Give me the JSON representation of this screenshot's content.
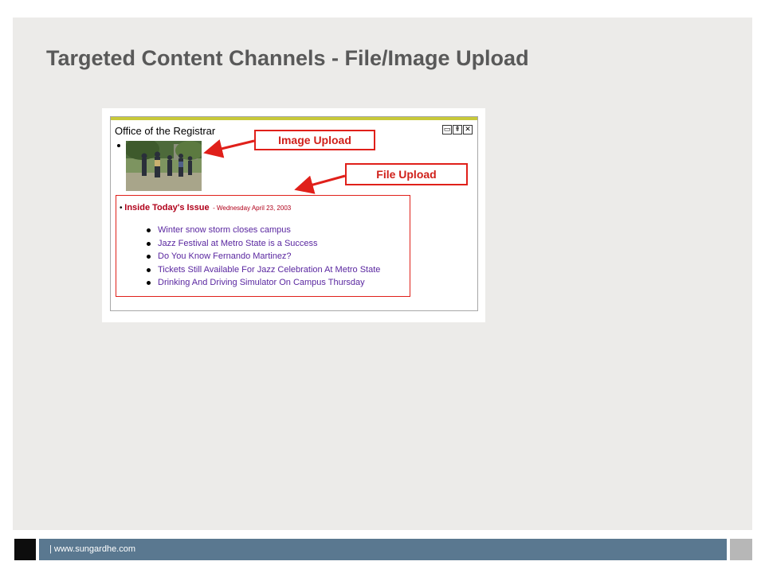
{
  "slide": {
    "title": "Targeted Content Channels - File/Image Upload"
  },
  "portal": {
    "title": "Office of the Registrar",
    "window_controls": [
      "restore-icon",
      "maximize-icon",
      "close-icon"
    ],
    "callouts": {
      "image_upload": "Image Upload",
      "file_upload": "File Upload"
    },
    "news": {
      "heading": "Inside Today's Issue",
      "date": "- Wednesday April 23, 2003",
      "items": [
        "Winter snow storm closes campus",
        "Jazz Festival at Metro State is a Success",
        "Do You Know Fernando Martinez?",
        "Tickets Still Available For Jazz Celebration At Metro State",
        "Drinking And Driving Simulator On Campus Thursday"
      ]
    }
  },
  "footer": {
    "text": "| www.sungardhe.com"
  },
  "colors": {
    "accent_red": "#e0201a",
    "link_purple": "#5a27a0",
    "footer_blue": "#5a7890",
    "title_gray": "#595959"
  }
}
